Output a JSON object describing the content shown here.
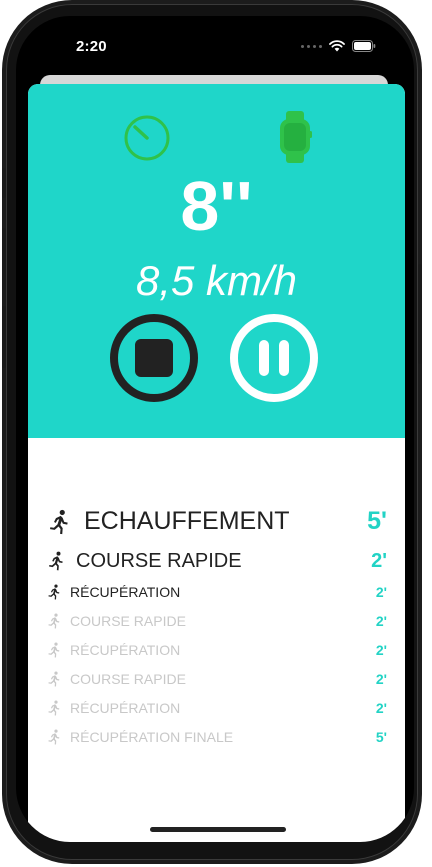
{
  "status_bar": {
    "time": "2:20"
  },
  "workout": {
    "timer": "8''",
    "speed": "8,5 km/h"
  },
  "steps": [
    {
      "label": "ECHAUFFEMENT",
      "duration": "5'",
      "state": "current"
    },
    {
      "label": "COURSE RAPIDE",
      "duration": "2'",
      "state": "next"
    },
    {
      "label": "RÉCUPÉRATION",
      "duration": "2'",
      "state": "upcoming"
    },
    {
      "label": "COURSE RAPIDE",
      "duration": "2'",
      "state": "faded"
    },
    {
      "label": "RÉCUPÉRATION",
      "duration": "2'",
      "state": "faded"
    },
    {
      "label": "COURSE RAPIDE",
      "duration": "2'",
      "state": "faded"
    },
    {
      "label": "RÉCUPÉRATION",
      "duration": "2'",
      "state": "faded"
    },
    {
      "label": "RÉCUPÉRATION FINALE",
      "duration": "5'",
      "state": "faded"
    }
  ],
  "colors": {
    "accent": "#1fd6c9",
    "duration": "#22d3c5",
    "icon_green": "#2fc24a",
    "stop": "#222222"
  },
  "icons": {
    "timer": "timer-icon",
    "watch": "watch-icon",
    "stop": "stop-icon",
    "pause": "pause-icon",
    "runner": "runner-icon"
  }
}
